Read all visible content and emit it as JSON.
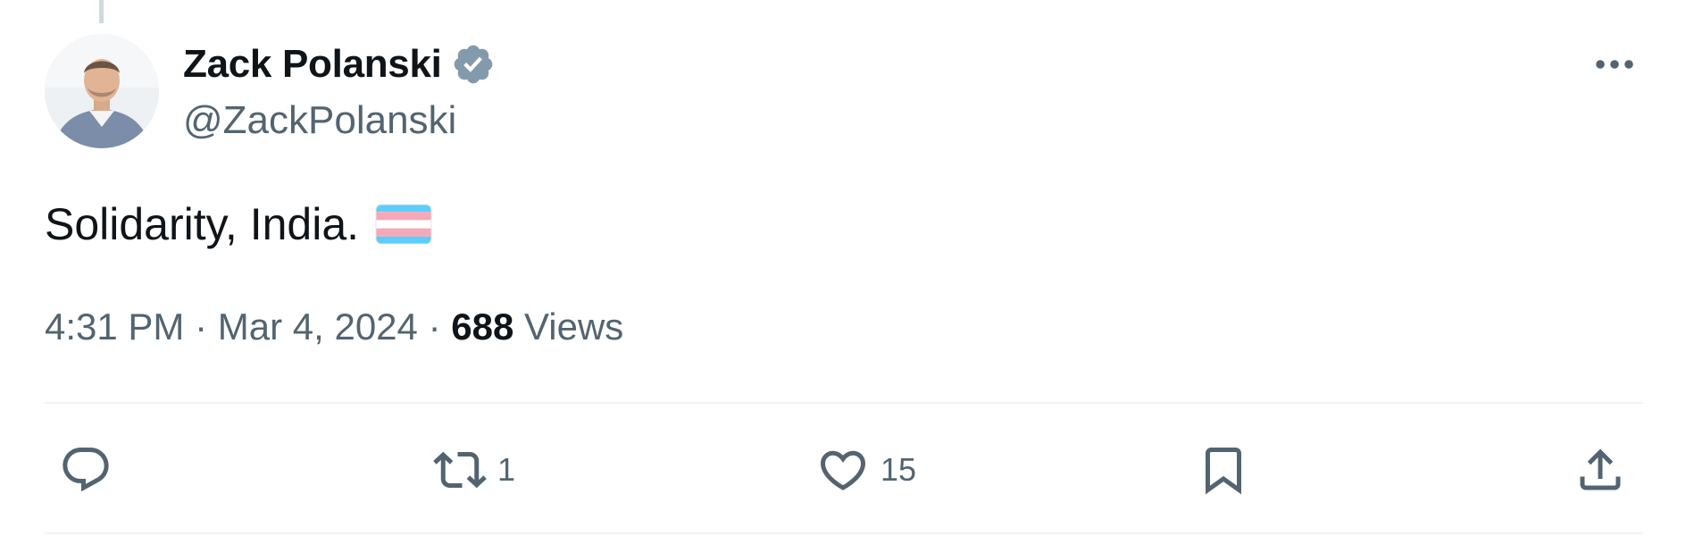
{
  "tweet": {
    "author": {
      "display_name": "Zack Polanski",
      "handle": "@ZackPolanski",
      "verified": true,
      "verified_color": "#829aab"
    },
    "text": "Solidarity, India.",
    "emoji": "transgender-flag",
    "time": "4:31 PM",
    "date": "Mar 4, 2024",
    "separator": "·",
    "views_count": "688",
    "views_label": "Views",
    "actions": {
      "reply": {
        "icon": "reply-icon",
        "count": ""
      },
      "retweet": {
        "icon": "retweet-icon",
        "count": "1"
      },
      "like": {
        "icon": "heart-icon",
        "count": "15"
      },
      "bookmark": {
        "icon": "bookmark-icon",
        "count": ""
      },
      "share": {
        "icon": "share-icon",
        "count": ""
      }
    }
  },
  "colors": {
    "text_primary": "#0f1419",
    "text_secondary": "#536471",
    "divider": "#eff3f4",
    "flag_blue": "#5bcefa",
    "flag_pink": "#f5a9b8",
    "flag_white": "#ffffff"
  }
}
